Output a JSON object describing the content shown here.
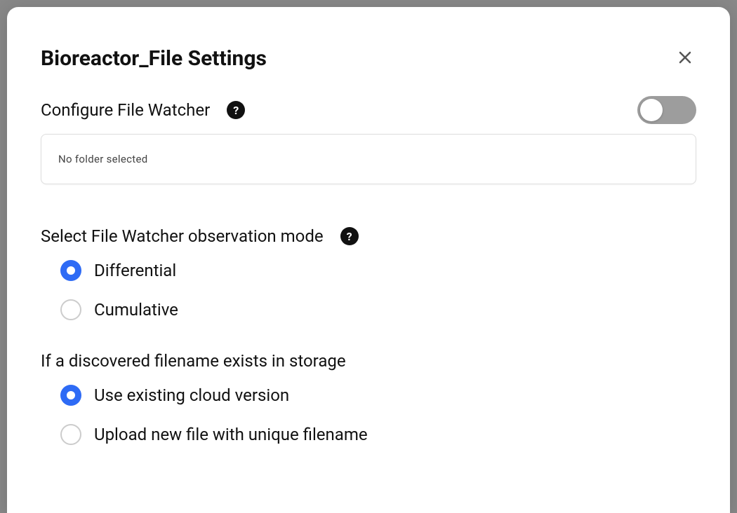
{
  "modal": {
    "title": "Bioreactor_File Settings"
  },
  "fileWatcher": {
    "label": "Configure File Watcher",
    "folderStatus": "No folder selected",
    "enabled": false
  },
  "observationMode": {
    "label": "Select File Watcher observation mode",
    "options": {
      "differential": "Differential",
      "cumulative": "Cumulative"
    },
    "selected": "differential"
  },
  "duplicateHandling": {
    "label": "If a discovered filename exists in storage",
    "options": {
      "useExisting": "Use existing cloud version",
      "uploadNew": "Upload new file with unique filename"
    },
    "selected": "useExisting"
  }
}
